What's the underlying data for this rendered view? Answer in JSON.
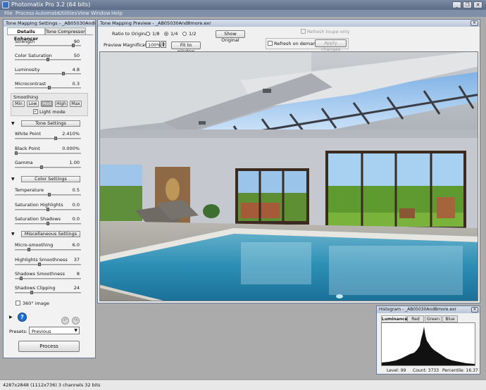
{
  "app": {
    "title": "Photomatix Pro 3.2 (64 bits)"
  },
  "menu": [
    "File",
    "Process",
    "Automate",
    "Utilities",
    "View",
    "Window",
    "Help"
  ],
  "window_buttons": {
    "minimize": "_",
    "restore": "❐",
    "close": "✕"
  },
  "left_panel": {
    "title": "Tone Mapping Settings - _AB05030And8...",
    "tabs": [
      "Details Enhancer",
      "Tone Compressor"
    ],
    "sliders_top": [
      {
        "label": "Strength",
        "value": "90",
        "position": 0.9
      },
      {
        "label": "Color Saturation",
        "value": "50",
        "position": 0.5
      },
      {
        "label": "Luminosity",
        "value": "4.8",
        "position": 0.74
      },
      {
        "label": "Microcontrast",
        "value": "0.3",
        "position": 0.52
      }
    ],
    "smoothing": {
      "label": "Smoothing",
      "buttons": [
        "Min",
        "Low",
        "Med",
        "High",
        "Max"
      ],
      "selected": "Med",
      "light_mode_label": "Light mode",
      "light_mode_checked": true
    },
    "tone_section": {
      "label": "Tone Settings",
      "sliders": [
        {
          "label": "White Point",
          "value": "2.410%",
          "position": 0.62
        },
        {
          "label": "Black Point",
          "value": "0.000%",
          "position": 0.0
        },
        {
          "label": "Gamma",
          "value": "1.00",
          "position": 0.4
        }
      ]
    },
    "color_section": {
      "label": "Color Settings",
      "sliders": [
        {
          "label": "Temperature",
          "value": "0.5",
          "position": 0.52
        },
        {
          "label": "Saturation Highlights",
          "value": "0.0",
          "position": 0.5
        },
        {
          "label": "Saturation Shadows",
          "value": "0.0",
          "position": 0.5
        }
      ]
    },
    "misc_section": {
      "label": "Miscellaneous Settings",
      "sliders": [
        {
          "label": "Micro-smoothing",
          "value": "6.0",
          "position": 0.2
        },
        {
          "label": "Highlights Smoothness",
          "value": "37",
          "position": 0.37
        },
        {
          "label": "Shadows Smoothness",
          "value": "8",
          "position": 0.08
        },
        {
          "label": "Shadows Clipping",
          "value": "24",
          "position": 0.24
        }
      ]
    },
    "image360_label": "360° image",
    "help_icon": "?",
    "presets_label": "Presets:",
    "presets_value": "Previous",
    "process_label": "Process"
  },
  "preview": {
    "title": "Tone Mapping Preview - _AB05030And8more.exr",
    "ratio_label": "Ratio to Original:",
    "ratio_options": [
      "1/8",
      "1/4",
      "1/2"
    ],
    "ratio_selected": "1/4",
    "show_original_label": "Show Original",
    "refresh_loupe_label": "Refresh loupe only",
    "magnification_label": "Preview Magnification:",
    "magnification_value": "100%",
    "fit_window_label": "Fit to window",
    "refresh_on_demand_label": "Refresh on demand:",
    "apply_changes_label": "Apply changes"
  },
  "histogram": {
    "title": "Histogram - _AB05030And8more.exr",
    "tabs": [
      "Luminance",
      "Red",
      "Green",
      "Blue"
    ],
    "selected_tab": "Luminance",
    "level": "Level: 99",
    "count": "Count: 3733",
    "percentile": "Percentile: 16.37"
  },
  "status_bar": "4287x2848 (1112x736) 3 channels 32 bits",
  "colors": {
    "titlebar": "#6a7a95",
    "panel_bg": "#f2f2f2",
    "workspace": "#ababab",
    "help_button": "#1f6fd1",
    "pool_water": "#2d8fb5"
  }
}
